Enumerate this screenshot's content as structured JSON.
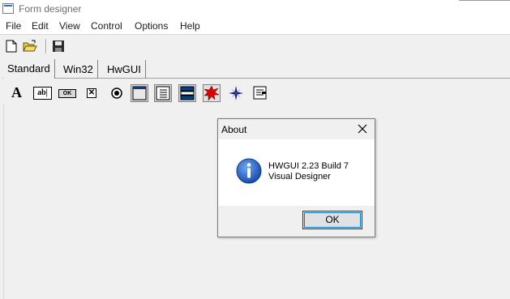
{
  "window": {
    "title": "Form designer",
    "icon": "window-icon"
  },
  "menu": [
    "File",
    "Edit",
    "View",
    "Control",
    "Options",
    "Help"
  ],
  "toolbar": {
    "buttons": [
      "new-file-icon",
      "open-folder-icon",
      "save-disk-icon"
    ]
  },
  "tabs": [
    {
      "label": "Standard",
      "active": true
    },
    {
      "label": "Win32",
      "active": false
    },
    {
      "label": "HwGUI",
      "active": false
    }
  ],
  "palette": {
    "label_glyph": "A",
    "edit_glyph": "ab|",
    "button_glyph": "OK",
    "checkbox_glyph": "✕",
    "items": [
      "label-tool-icon",
      "edit-tool-icon",
      "button-tool-icon",
      "checkbox-tool-icon",
      "radio-tool-icon",
      "panel-tool-icon",
      "listbox-tool-icon",
      "combobox-tool-icon",
      "image-tool-icon",
      "star-tool-icon",
      "text-tool-icon"
    ]
  },
  "dialog": {
    "title": "About",
    "line1": "HWGUI 2.23 Build 7",
    "line2": "Visual Designer",
    "ok_label": "OK",
    "icon": "info-icon",
    "accent": "#0078d7"
  }
}
